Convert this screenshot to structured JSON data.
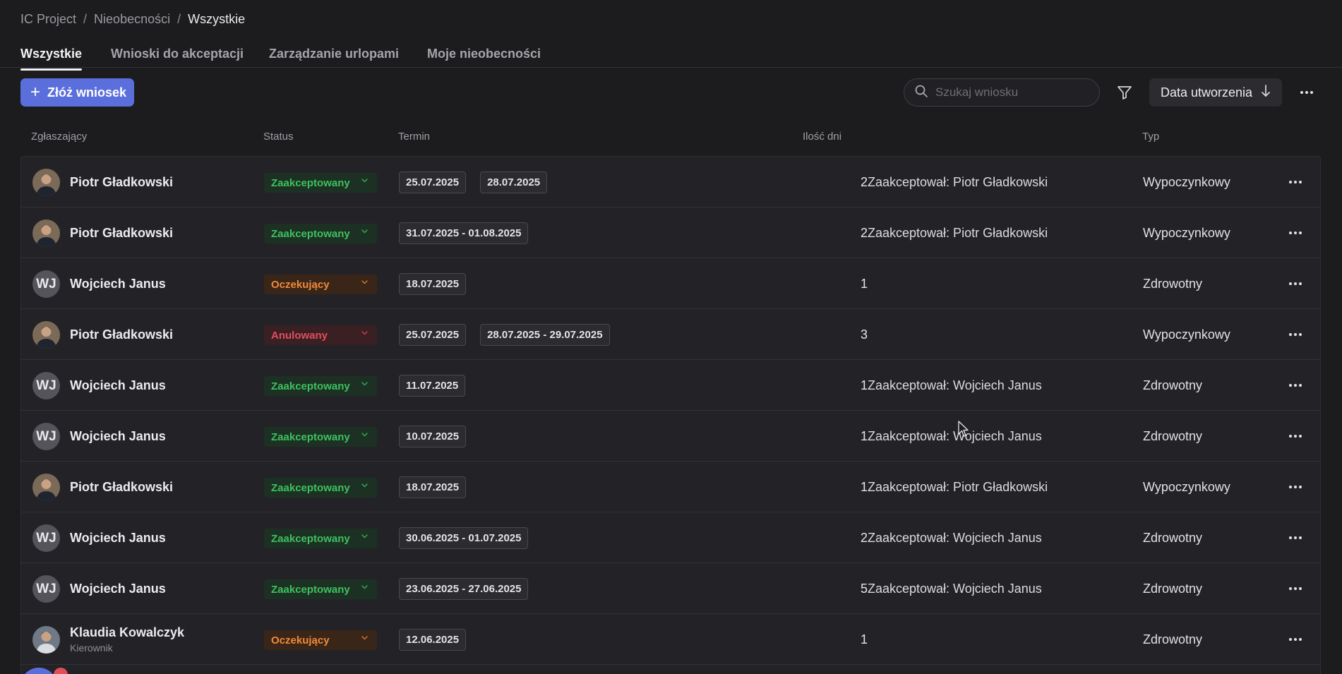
{
  "breadcrumb": {
    "items": [
      "IC Project",
      "Nieobecności"
    ],
    "separator": "/",
    "current": "Wszystkie"
  },
  "tabs": [
    {
      "label": "Wszystkie",
      "active": true
    },
    {
      "label": "Wnioski do akceptacji",
      "active": false
    },
    {
      "label": "Zarządzanie urlopami",
      "active": false
    },
    {
      "label": "Moje nieobecności",
      "active": false
    }
  ],
  "toolbar": {
    "new_request_label": "Złóż wniosek",
    "search_placeholder": "Szukaj wniosku",
    "sort_label": "Data utworzenia",
    "filter_icon": "filter-icon",
    "sort_icon": "arrow-down-icon"
  },
  "columns": {
    "requester": "Zgłaszający",
    "status": "Status",
    "term": "Termin",
    "days": "Ilość dni",
    "type": "Typ"
  },
  "status_colors": {
    "accepted": "#3ec15e",
    "pending": "#ef8a3a",
    "cancelled": "#e14f5c"
  },
  "rows": [
    {
      "name": "Piotr Gładkowski",
      "role": "",
      "avatar": "photo",
      "initials": "",
      "status": "Zaakceptowany",
      "status_kind": "accepted",
      "dates": [
        "25.07.2025",
        "28.07.2025"
      ],
      "days": "2",
      "approver": "Zaakceptował: Piotr Gładkowski",
      "type": "Wypoczynkowy"
    },
    {
      "name": "Piotr Gładkowski",
      "role": "",
      "avatar": "photo",
      "initials": "",
      "status": "Zaakceptowany",
      "status_kind": "accepted",
      "dates": [
        "31.07.2025 - 01.08.2025"
      ],
      "days": "2",
      "approver": "Zaakceptował: Piotr Gładkowski",
      "type": "Wypoczynkowy"
    },
    {
      "name": "Wojciech Janus",
      "role": "",
      "avatar": "initials",
      "initials": "WJ",
      "status": "Oczekujący",
      "status_kind": "pending",
      "dates": [
        "18.07.2025"
      ],
      "days": "1",
      "approver": "",
      "type": "Zdrowotny"
    },
    {
      "name": "Piotr Gładkowski",
      "role": "",
      "avatar": "photo",
      "initials": "",
      "status": "Anulowany",
      "status_kind": "cancelled",
      "dates": [
        "25.07.2025",
        "28.07.2025 - 29.07.2025"
      ],
      "days": "3",
      "approver": "",
      "type": "Wypoczynkowy"
    },
    {
      "name": "Wojciech Janus",
      "role": "",
      "avatar": "initials",
      "initials": "WJ",
      "status": "Zaakceptowany",
      "status_kind": "accepted",
      "dates": [
        "11.07.2025"
      ],
      "days": "1",
      "approver": "Zaakceptował: Wojciech Janus",
      "type": "Zdrowotny"
    },
    {
      "name": "Wojciech Janus",
      "role": "",
      "avatar": "initials",
      "initials": "WJ",
      "status": "Zaakceptowany",
      "status_kind": "accepted",
      "dates": [
        "10.07.2025"
      ],
      "days": "1",
      "approver": "Zaakceptował: Wojciech Janus",
      "type": "Zdrowotny"
    },
    {
      "name": "Piotr Gładkowski",
      "role": "",
      "avatar": "photo",
      "initials": "",
      "status": "Zaakceptowany",
      "status_kind": "accepted",
      "dates": [
        "18.07.2025"
      ],
      "days": "1",
      "approver": "Zaakceptował: Piotr Gładkowski",
      "type": "Wypoczynkowy"
    },
    {
      "name": "Wojciech Janus",
      "role": "",
      "avatar": "initials",
      "initials": "WJ",
      "status": "Zaakceptowany",
      "status_kind": "accepted",
      "dates": [
        "30.06.2025 - 01.07.2025"
      ],
      "days": "2",
      "approver": "Zaakceptował: Wojciech Janus",
      "type": "Zdrowotny"
    },
    {
      "name": "Wojciech Janus",
      "role": "",
      "avatar": "initials",
      "initials": "WJ",
      "status": "Zaakceptowany",
      "status_kind": "accepted",
      "dates": [
        "23.06.2025 - 27.06.2025"
      ],
      "days": "5",
      "approver": "Zaakceptował: Wojciech Janus",
      "type": "Zdrowotny"
    },
    {
      "name": "Klaudia Kowalczyk",
      "role": "Kierownik",
      "avatar": "photo-female",
      "initials": "",
      "status": "Oczekujący",
      "status_kind": "pending",
      "dates": [
        "12.06.2025"
      ],
      "days": "1",
      "approver": "",
      "type": "Zdrowotny"
    }
  ]
}
